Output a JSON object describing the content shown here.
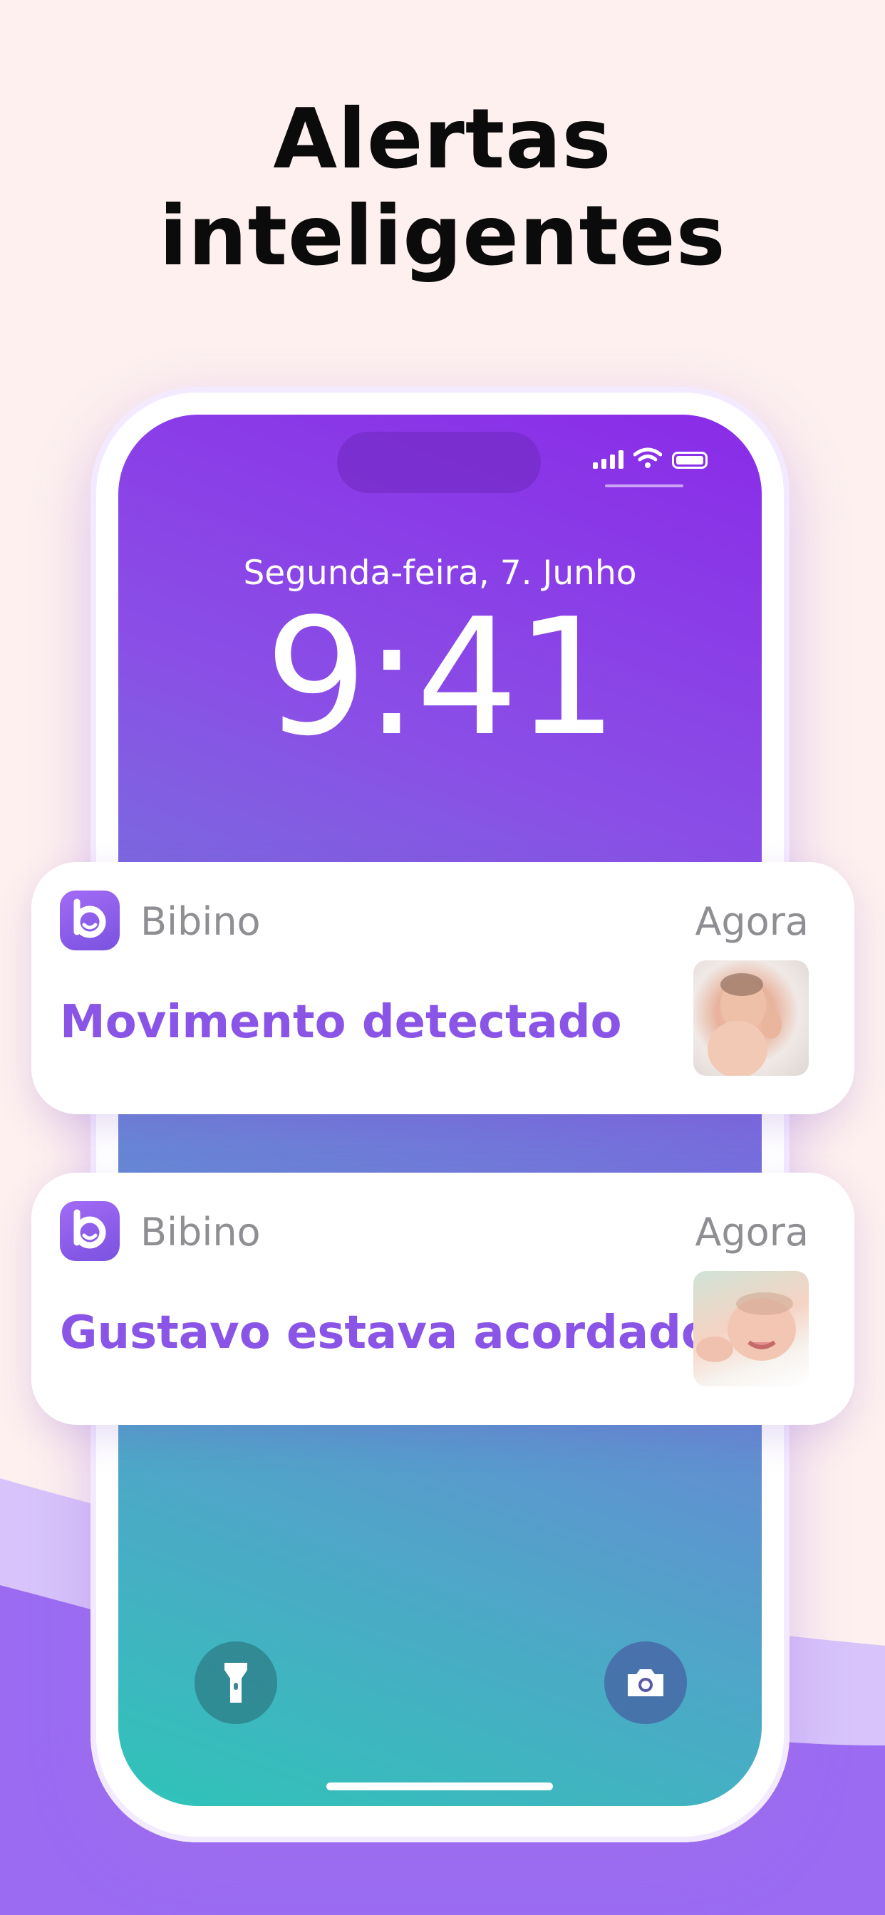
{
  "headline": {
    "line1": "Alertas",
    "line2": "inteligentes"
  },
  "lock_screen": {
    "date": "Segunda-feira, 7. Junho",
    "time": "9:41"
  },
  "notifications": [
    {
      "app_name": "Bibino",
      "time": "Agora",
      "message": "Movimento detectado",
      "thumbnail": "sleeping-baby-photo"
    },
    {
      "app_name": "Bibino",
      "time": "Agora",
      "message": "Gustavo estava acordado!",
      "thumbnail": "smiling-baby-photo"
    }
  ],
  "icons": {
    "app": "bibino-logo-icon",
    "flashlight": "flashlight-icon",
    "camera": "camera-icon",
    "signal": "cellular-signal-icon",
    "wifi": "wifi-icon",
    "battery": "battery-icon"
  },
  "colors": {
    "accent": "#8a55e6",
    "background": "#fdf0ef",
    "wave": "#9b6cf2"
  }
}
